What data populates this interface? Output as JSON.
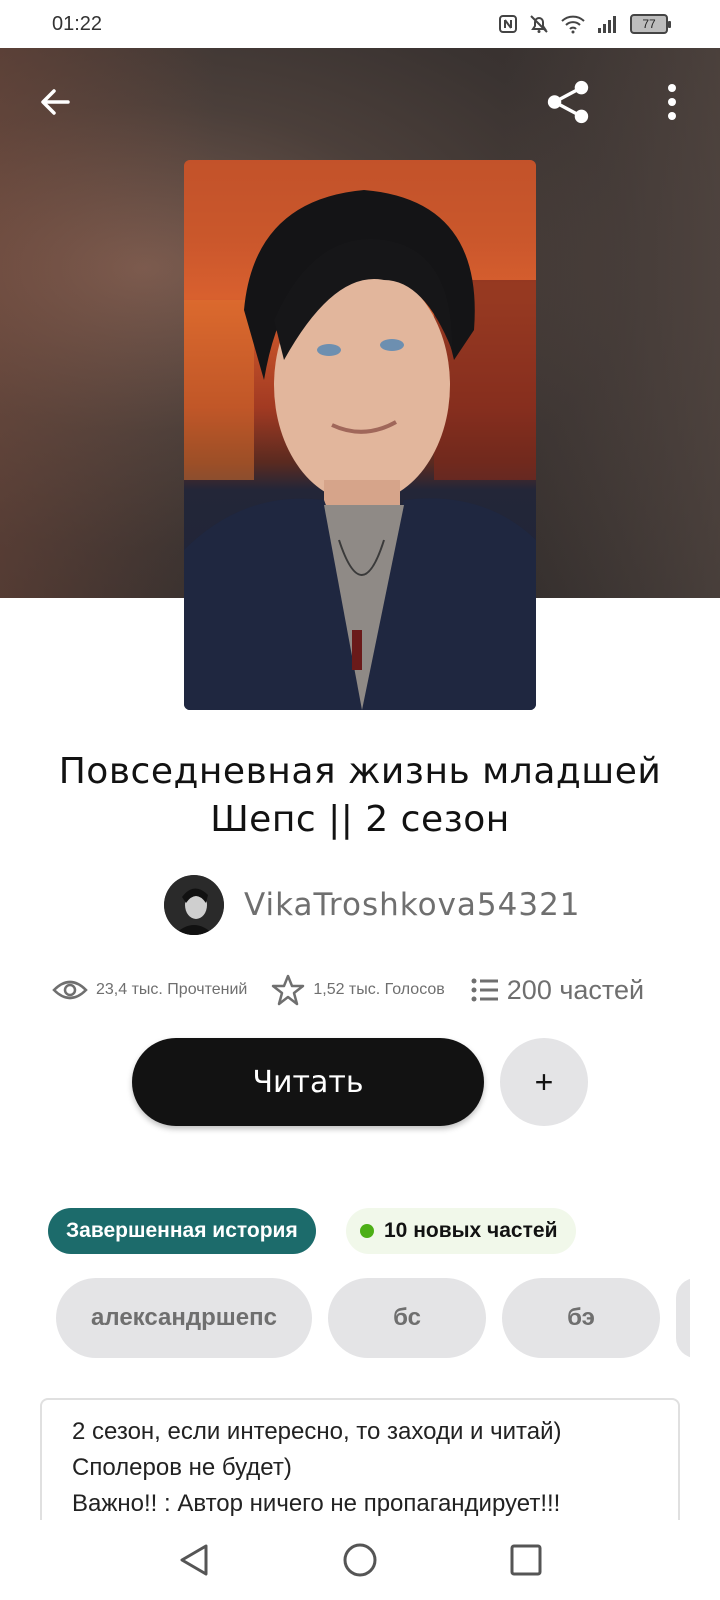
{
  "status_bar": {
    "time": "01:22",
    "battery": "77",
    "icons": [
      "nfc-icon",
      "bell-muted-icon",
      "wifi-icon",
      "signal-icon",
      "battery-icon"
    ]
  },
  "toolbar": {
    "back_icon": "arrow-left-icon",
    "share_icon": "share-icon",
    "more_icon": "more-vertical-icon"
  },
  "story": {
    "title": "Повседневная жизнь младшей Шепс || 2 сезон",
    "author": "VikaTroshkova54321",
    "stats": {
      "reads": "23,4 тыс. Прочтений",
      "votes": "1,52 тыс. Голосов",
      "parts": "200 частей"
    },
    "read_label": "Читать",
    "add_label": "+",
    "status_badge": "Завершенная история",
    "new_parts_badge": "10 новых частей",
    "tags": [
      "александршепс",
      "бс",
      "бэ"
    ],
    "description": [
      "2 сезон, если интересно, то заходи и читай)",
      "Сполеров не будет)",
      "Важно!! : Автор ничего не пропагандирует!!!"
    ]
  },
  "colors": {
    "primary_button": "#121212",
    "complete_badge": "#1c6b6b",
    "new_dot": "#4caf16",
    "tag_bg": "#e4e4e6"
  },
  "nav_bar": {
    "icons": [
      "back-triangle-icon",
      "home-circle-icon",
      "recents-square-icon"
    ]
  }
}
